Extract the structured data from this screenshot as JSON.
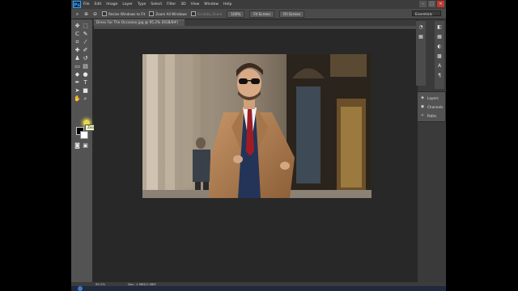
{
  "app": {
    "logo": "Ps"
  },
  "menu": [
    "File",
    "Edit",
    "Image",
    "Layer",
    "Type",
    "Select",
    "Filter",
    "3D",
    "View",
    "Window",
    "Help"
  ],
  "window_controls": [
    "–",
    "□",
    "✕"
  ],
  "options_bar": {
    "resize_windows_label": "Resize Windows to Fit",
    "zoom_all_label": "Zoom All Windows",
    "scrubby_zoom_label": "Scrubby Zoom",
    "btn_100": "100%",
    "btn_fit": "Fit Screen",
    "btn_fill": "Fill Screen",
    "workspace": "Essentials"
  },
  "document": {
    "tab_title": "Dress For The Occasion.jpg @ 95.2% (RGB/8#)"
  },
  "tooltip": "Zoom Tool (Z)",
  "panels": {
    "layers": "Layers",
    "channels": "Channels",
    "paths": "Paths"
  },
  "status": {
    "zoom": "95.2%",
    "doc": "Doc: 1.98M/1.98M"
  },
  "colors": {
    "foreground": "#000000",
    "background": "#ffffff",
    "accent": "#31a8ff"
  }
}
